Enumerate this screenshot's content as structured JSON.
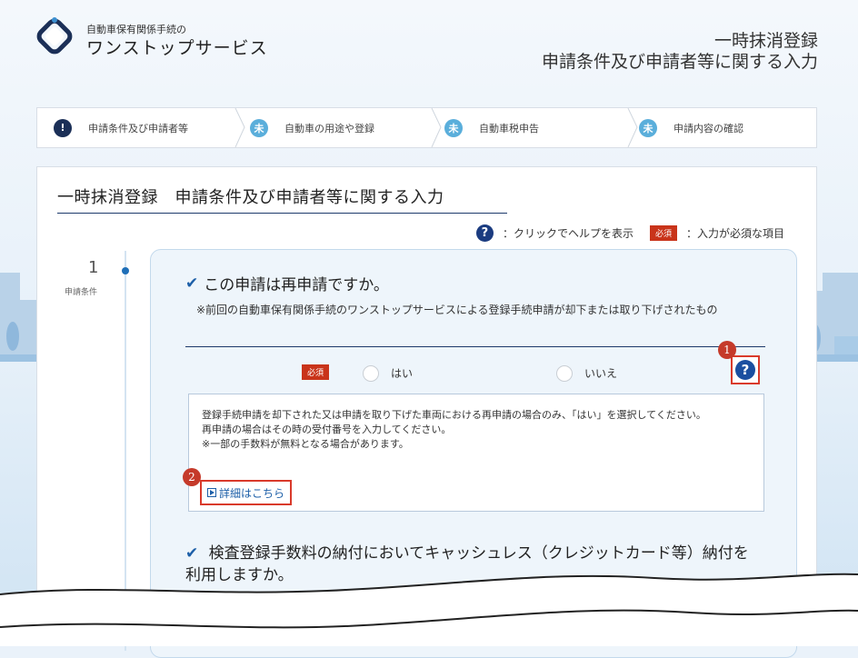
{
  "header": {
    "brand_small": "自動車保有関係手続の",
    "brand_big": "ワンストップサービス",
    "title_line1": "一時抹消登録",
    "title_line2": "申請条件及び申請者等に関する入力"
  },
  "steps": [
    {
      "icon": "!",
      "label": "申請条件及び申請者等",
      "state": "current"
    },
    {
      "icon": "未",
      "label": "自動車の用途や登録",
      "state": "todo"
    },
    {
      "icon": "未",
      "label": "自動車税申告",
      "state": "todo"
    },
    {
      "icon": "未",
      "label": "申請内容の確認",
      "state": "todo"
    }
  ],
  "panel": {
    "title": "一時抹消登録　申請条件及び申請者等に関する入力",
    "legend_help": "：クリックでヘルプを表示",
    "legend_required_badge": "必須",
    "legend_required": "：入力が必須な項目"
  },
  "section": {
    "number": "1",
    "label": "申請条件"
  },
  "question1": {
    "title": "この申請は再申請ですか。",
    "note": "　※前回の自動車保有関係手続のワンストップサービスによる登録手続申請が却下または取り下げされたもの",
    "required_badge": "必須",
    "option_yes": "はい",
    "option_no": "いいえ",
    "help_lines": [
      "登録手続申請を却下された又は申請を取り下げた車両における再申請の場合のみ、「はい」を選択してください。",
      "再申請の場合はその時の受付番号を入力してください。",
      "※一部の手数料が無料となる場合があります。"
    ],
    "details_link": "詳細はこちら"
  },
  "question2": {
    "title": "検査登録手数料の納付においてキャッシュレス（クレジットカード等）納付を利用しますか。"
  },
  "markers": {
    "help_marker": "1",
    "link_marker": "2"
  },
  "colors": {
    "accent_navy": "#1b2f57",
    "step_todo": "#5aaedb",
    "required_red": "#c9341a",
    "highlight_red": "#d93a2b",
    "link_blue": "#1d5fa8"
  }
}
